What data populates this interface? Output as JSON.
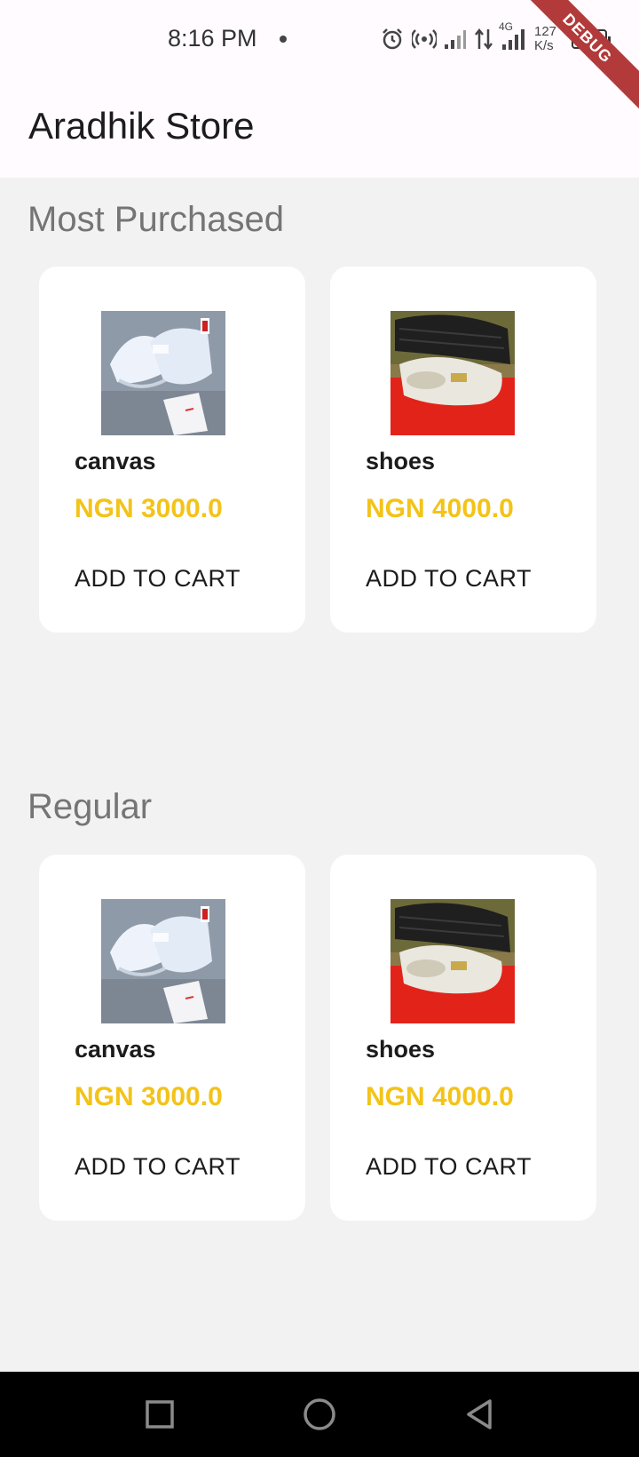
{
  "status_bar": {
    "time": "8:16 PM",
    "network_type": "4G",
    "speed_value": "127",
    "speed_unit": "K/s",
    "battery_level": 0.9
  },
  "debug_banner": "DEBUG",
  "app_bar": {
    "title": "Aradhik Store"
  },
  "sections": [
    {
      "title": "Most Purchased",
      "products": [
        {
          "name": "canvas",
          "price": "NGN 3000.0",
          "button": "ADD TO CART",
          "image": "white-sneakers"
        },
        {
          "name": "shoes",
          "price": "NGN 4000.0",
          "button": "ADD TO CART",
          "image": "white-loafers"
        }
      ]
    },
    {
      "title": "Regular",
      "products": [
        {
          "name": "canvas",
          "price": "NGN 3000.0",
          "button": "ADD TO CART",
          "image": "white-sneakers"
        },
        {
          "name": "shoes",
          "price": "NGN 4000.0",
          "button": "ADD TO CART",
          "image": "white-loafers"
        }
      ]
    }
  ],
  "nav_bar": {
    "recents_icon": "square-icon",
    "home_icon": "circle-icon",
    "back_icon": "triangle-back-icon"
  },
  "colors": {
    "price": "#f3c318",
    "app_bar_bg": "#fffbfe",
    "page_bg": "#f2f2f2",
    "debug_banner": "#b23a3a"
  }
}
